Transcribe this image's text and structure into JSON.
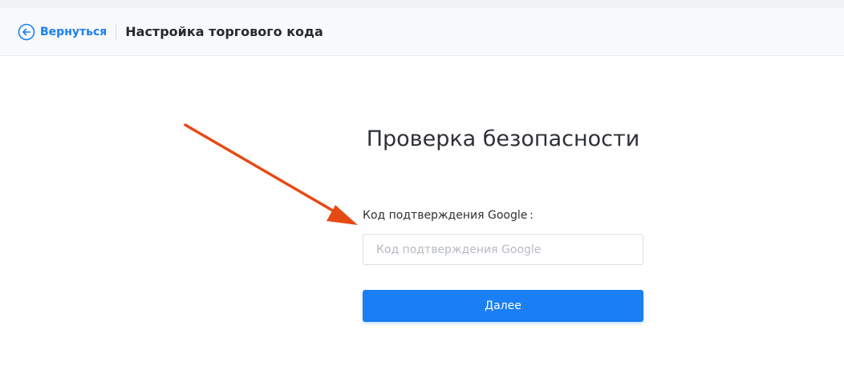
{
  "header": {
    "back_label": "Вернуться",
    "title": "Настройка торгового кода"
  },
  "form": {
    "title": "Проверка безопасности",
    "code_label": "Код подтверждения Google :",
    "code_value": "",
    "code_placeholder": "Код подтверждения Google",
    "submit_label": "Далее"
  },
  "colors": {
    "accent": "#1a7ff4",
    "annotation_arrow": "#e64a14",
    "header_bg": "#f8f9fb"
  },
  "icons": {
    "back": "arrow-left-circle-icon",
    "annotation": "arrow-annotation"
  }
}
